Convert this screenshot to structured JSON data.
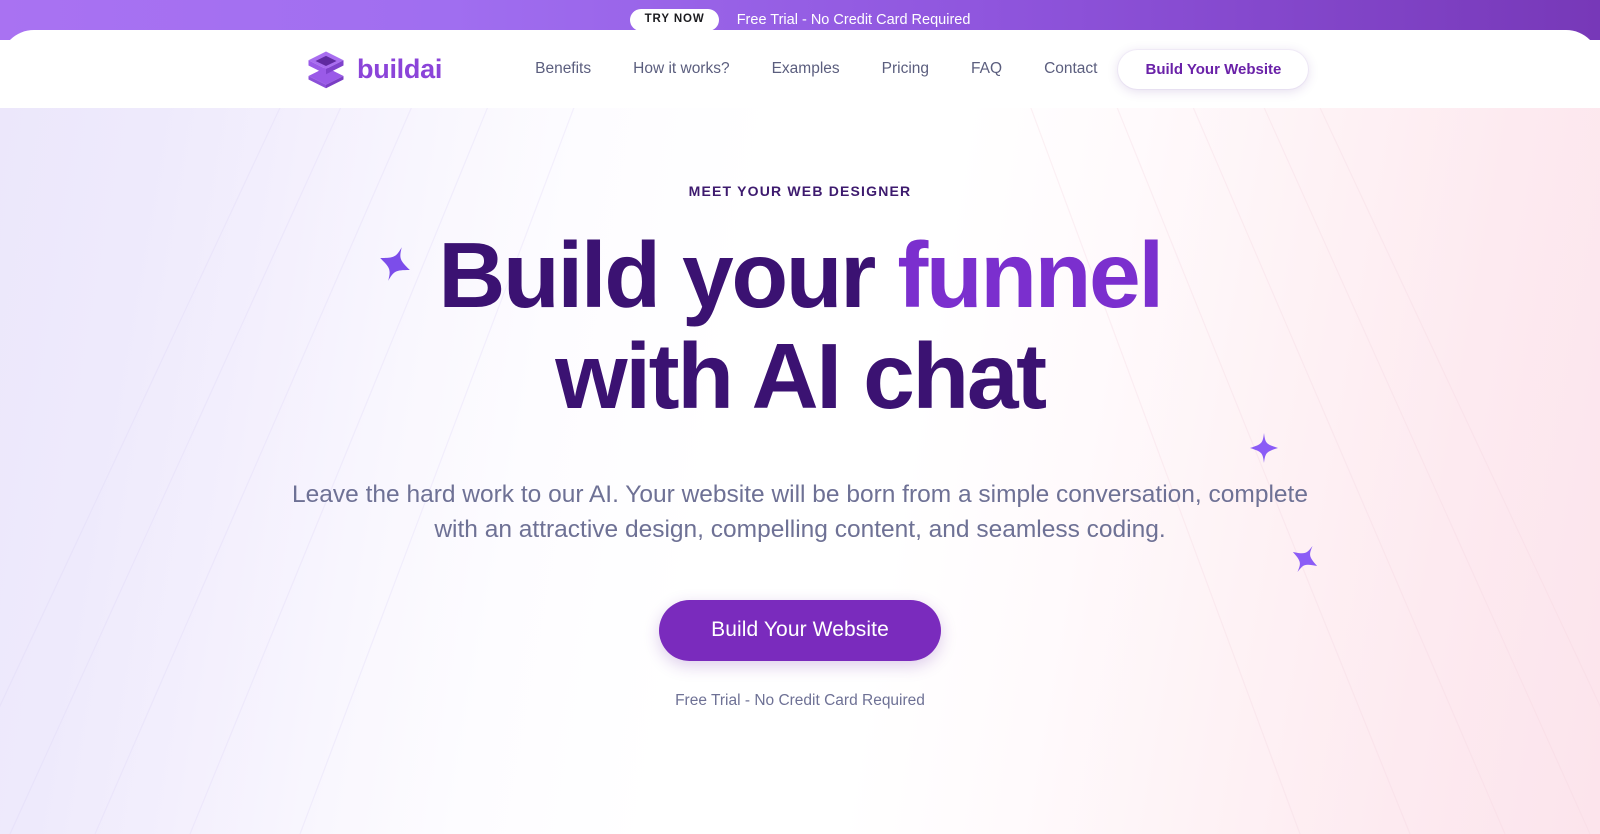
{
  "promo_banner": {
    "pill_label": "TRY NOW",
    "message": "Free Trial - No Credit Card Required",
    "gradient_from": "#a972f2",
    "gradient_to": "#7738b8"
  },
  "header": {
    "logo": {
      "icon": "stacked-cube-logo-icon",
      "wordmark": "buildai",
      "color": "#8b44d9"
    },
    "nav": [
      {
        "label": "Benefits"
      },
      {
        "label": "How it works?"
      },
      {
        "label": "Examples"
      },
      {
        "label": "Pricing"
      },
      {
        "label": "FAQ"
      },
      {
        "label": "Contact"
      }
    ],
    "cta_label": "Build Your Website",
    "cta_text_color": "#6a21a8"
  },
  "hero": {
    "eyebrow": "MEET YOUR WEB DESIGNER",
    "headline_line1_plain": "Build your ",
    "headline_line1_accent": "funnel",
    "headline_line2": "with AI chat",
    "headline_color": "#3b1272",
    "headline_accent_color": "#7b2fce",
    "subheading": "Leave the hard work to our AI. Your website will be born from a simple conversation, complete with an attractive design, compelling content, and seamless coding.",
    "cta_label": "Build Your Website",
    "cta_bg": "#7a2bbd",
    "note": "Free Trial - No Credit Card Required",
    "background_left": "#ece7fb",
    "background_right": "#fce4ec",
    "decorations": [
      {
        "name": "sparkle-left",
        "color": "#7c4dea"
      },
      {
        "name": "sparkle-right-upper",
        "color": "#8b5cf6"
      },
      {
        "name": "sparkle-right-lower",
        "color": "#8b5cf6"
      }
    ]
  }
}
